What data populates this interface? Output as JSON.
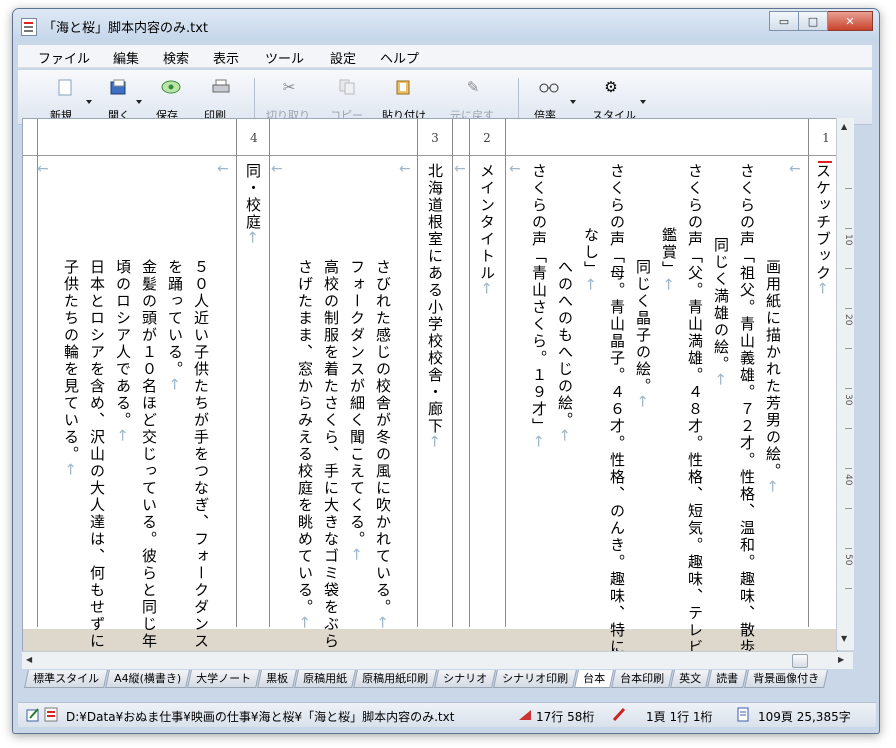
{
  "window": {
    "title": "「海と桜」脚本内容のみ.txt",
    "controls": {
      "minimize": "▭",
      "maximize": "□",
      "close": "✕"
    }
  },
  "menu": [
    "ファイル",
    "編集",
    "検索",
    "表示",
    "ツール",
    "設定",
    "ヘルプ"
  ],
  "toolbar": {
    "new": "新規",
    "open": "開く",
    "save": "保存",
    "print": "印刷",
    "cut": "切り取り",
    "copy": "コピー",
    "paste": "貼り付け",
    "undo": "元に戻す",
    "zoom": "倍率",
    "style": "スタイル"
  },
  "document": {
    "column_numbers": [
      "1",
      "2",
      "3",
      "4"
    ],
    "lines": {
      "l1": "スケッチブック",
      "l2": "画用紙に描かれた芳男の絵。",
      "l3": "さくらの声「祖父。青山義雄。７２才。性格、温和。趣味、散歩」",
      "l4": "同じく満雄の絵。",
      "l5": "さくらの声「父。青山満雄。４８才。性格、短気。趣味、テレビ",
      "l6": "鑑賞」",
      "l7": "同じく晶子の絵。",
      "l8": "さくらの声「母。青山晶子。４６才。性格、のんき。趣味、特に",
      "l9": "なし」",
      "l10": "へのへのもへじの絵。",
      "l11": "さくらの声「青山さくら。１９才」",
      "l12": "メインタイトル",
      "l13": "北海道根室にある小学校校舎・廊下",
      "l14": "さびれた感じの校舎が冬の風に吹かれている。",
      "l15": "フォークダンスが細く聞こえてくる。",
      "l16": "高校の制服を着たさくら、手に大きなゴミ袋をぶら",
      "l17": "さげたまま、窓からみえる校庭を眺めている。",
      "l18": "同・校庭",
      "l19": "５０人近い子供たちが手をつなぎ、フォークダンス",
      "l20": "を踊っている。",
      "l21": "金髪の頭が１０名ほど交じっている。彼らと同じ年",
      "l22": "頃のロシア人である。",
      "l23": "日本とロシアを含め、沢山の大人達は、何もせずに",
      "l24": "子供たちの輪を見ている。"
    },
    "ruler": [
      "10",
      "20",
      "30",
      "40",
      "50"
    ]
  },
  "tabs": [
    "標準スタイル",
    "A4縦(横書き)",
    "大学ノート",
    "黒板",
    "原稿用紙",
    "原稿用紙印刷",
    "シナリオ",
    "シナリオ印刷",
    "台本",
    "台本印刷",
    "英文",
    "読書",
    "背景画像付き"
  ],
  "active_tab": "台本",
  "status": {
    "path": "D:¥Data¥おぬま仕事¥映画の仕事¥海と桜¥「海と桜」脚本内容のみ.txt",
    "line_col": "17行 58桁",
    "page_pos": "1頁 1行 1桁",
    "counts": "109頁 25,385字"
  },
  "colors": {
    "accent": "#e02020",
    "return_mark": "#9fb8c9",
    "page_bottom": "#ddd7cc"
  }
}
